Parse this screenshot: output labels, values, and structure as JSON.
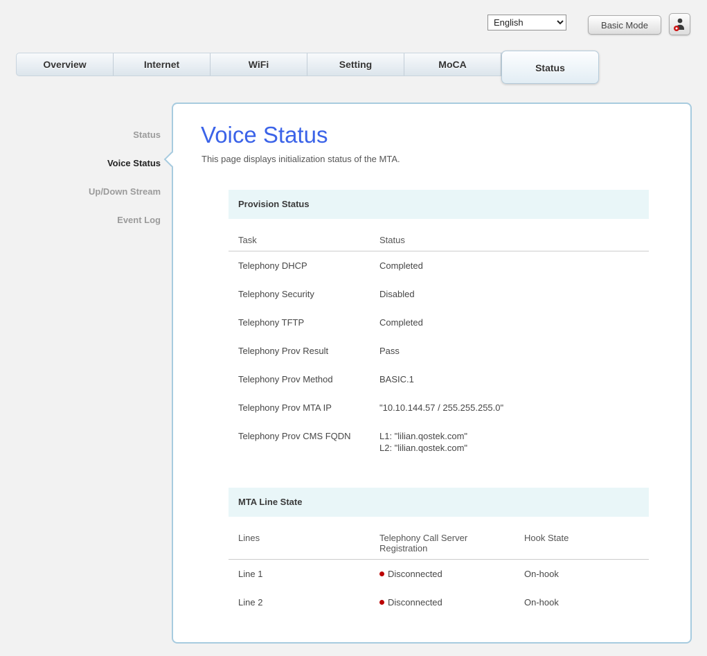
{
  "header": {
    "language": {
      "value": "English",
      "options": [
        "English"
      ]
    },
    "mode_button_label": "Basic Mode"
  },
  "tabs": [
    {
      "label": "Overview",
      "active": false
    },
    {
      "label": "Internet",
      "active": false
    },
    {
      "label": "WiFi",
      "active": false
    },
    {
      "label": "Setting",
      "active": false
    },
    {
      "label": "MoCA",
      "active": false
    },
    {
      "label": "Status",
      "active": true
    }
  ],
  "sidebar": {
    "items": [
      {
        "label": "Status",
        "active": false
      },
      {
        "label": "Voice Status",
        "active": true
      },
      {
        "label": "Up/Down Stream",
        "active": false
      },
      {
        "label": "Event Log",
        "active": false
      }
    ]
  },
  "main": {
    "title": "Voice Status",
    "description": "This page displays initialization status of the MTA.",
    "sections": [
      {
        "heading": "Provision Status",
        "columns": [
          "Task",
          "Status"
        ],
        "rows": [
          [
            "Telephony DHCP",
            "Completed"
          ],
          [
            "Telephony Security",
            "Disabled"
          ],
          [
            "Telephony TFTP",
            "Completed"
          ],
          [
            "Telephony Prov Result",
            "Pass"
          ],
          [
            "Telephony Prov Method",
            "BASIC.1"
          ],
          [
            "Telephony Prov MTA IP",
            "\"10.10.144.57 / 255.255.255.0\""
          ],
          [
            "Telephony Prov CMS FQDN",
            [
              "L1: \"lilian.qostek.com\"",
              "L2: \"lilian.qostek.com\""
            ]
          ]
        ]
      },
      {
        "heading": "MTA Line State",
        "columns": [
          "Lines",
          "Telephony Call Server Registration",
          "Hook State"
        ],
        "rows": [
          [
            "Line 1",
            {
              "text": "Disconnected",
              "dot": true
            },
            "On-hook"
          ],
          [
            "Line 2",
            {
              "text": "Disconnected",
              "dot": true
            },
            "On-hook"
          ]
        ]
      }
    ]
  },
  "colors": {
    "accent_blue": "#3b63e8",
    "panel_border": "#a7cbdf",
    "band_bg": "#e9f6f8",
    "status_red": "#bb0000",
    "page_bg": "#f2f2f2"
  }
}
